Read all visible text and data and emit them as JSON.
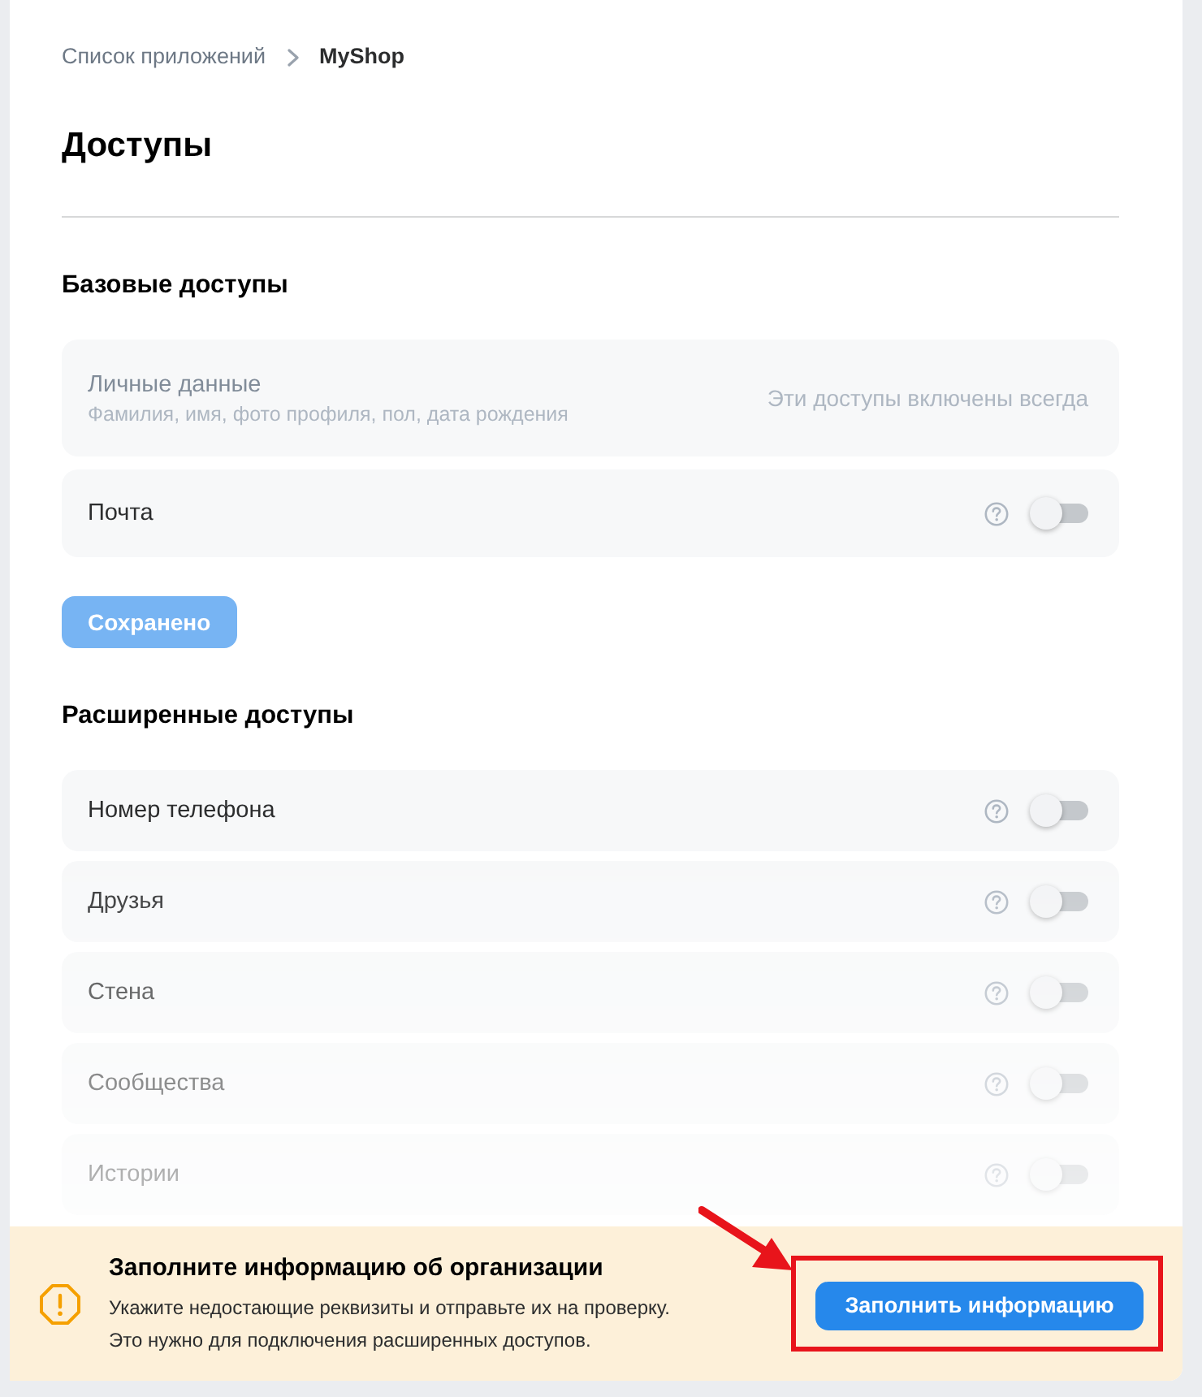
{
  "breadcrumbs": [
    {
      "label": "Список приложений",
      "current": false
    },
    {
      "label": "MyShop",
      "current": true
    }
  ],
  "title": "Доступы",
  "sections": [
    {
      "heading": "Базовые доступы",
      "items": [
        {
          "kind": "always",
          "label": "Личные данные",
          "description": "Фамилия, имя, фото профиля, пол, дата рождения",
          "note": "Эти доступы включены всегда"
        },
        {
          "kind": "toggle",
          "label": "Почта",
          "on": false
        }
      ],
      "save_button": {
        "label": "Сохранено",
        "disabled": true
      }
    },
    {
      "heading": "Расширенные доступы",
      "items": [
        {
          "kind": "toggle",
          "label": "Номер телефона",
          "on": false
        },
        {
          "kind": "toggle",
          "label": "Друзья",
          "on": false
        },
        {
          "kind": "toggle",
          "label": "Стена",
          "on": false
        },
        {
          "kind": "toggle",
          "label": "Сообщества",
          "on": false
        },
        {
          "kind": "toggle",
          "label": "Истории",
          "on": false
        }
      ]
    }
  ],
  "banner": {
    "title": "Заполните информацию об организации",
    "lines": [
      "Укажите недостающие реквизиты и отправьте их на проверку.",
      "Это нужно для подключения расширенных доступов."
    ],
    "button": {
      "label": "Заполнить информацию",
      "highlighted": true
    }
  }
}
